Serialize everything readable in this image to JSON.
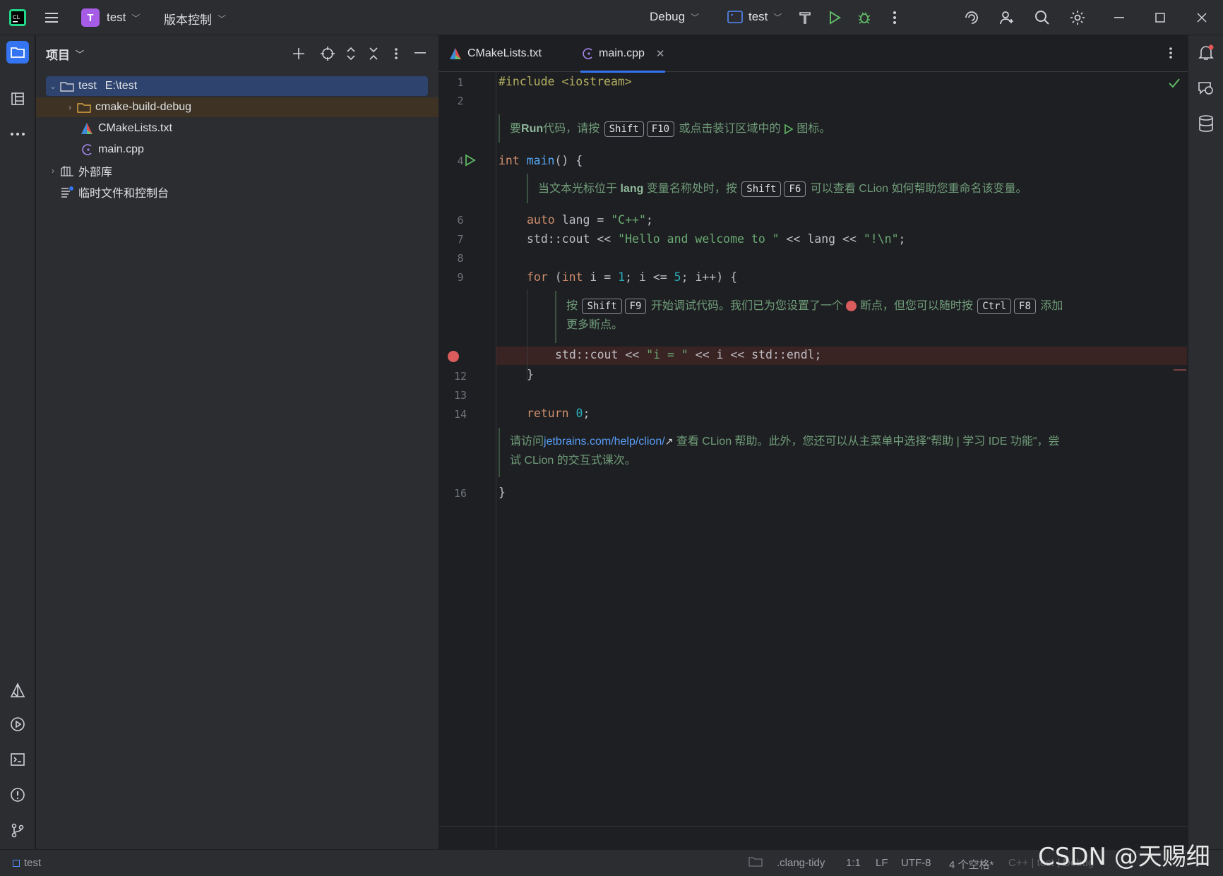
{
  "titlebar": {
    "project_initial": "T",
    "project_name": "test",
    "vcs_menu": "版本控制",
    "run_config": "Debug",
    "target": "test"
  },
  "project_panel": {
    "title": "项目",
    "tree": [
      {
        "label": "test",
        "hint": "E:\\test",
        "icon": "folder-icon"
      },
      {
        "label": "cmake-build-debug",
        "icon": "folder-icon"
      },
      {
        "label": "CMakeLists.txt",
        "icon": "cmake-icon"
      },
      {
        "label": "main.cpp",
        "icon": "cpp-file-icon"
      },
      {
        "label": "外部库",
        "icon": "library-icon"
      },
      {
        "label": "临时文件和控制台",
        "icon": "scratch-icon"
      }
    ]
  },
  "tabs": [
    {
      "label": "CMakeLists.txt"
    },
    {
      "label": "main.cpp"
    }
  ],
  "editor": {
    "line_numbers": [
      "1",
      "2",
      "4",
      "6",
      "7",
      "8",
      "9",
      "12",
      "13",
      "14",
      "16"
    ],
    "lines": {
      "l1": "#include <iostream>",
      "l4_kw": "int",
      "l4_fn": "main",
      "l4_rest": "() {",
      "l6_kw": "auto",
      "l6_mid": " lang = ",
      "l6_str": "\"C++\"",
      "l6_end": ";",
      "l7_a": "std::cout << ",
      "l7_str1": "\"Hello and welcome to \"",
      "l7_b": " << lang << ",
      "l7_str2": "\"!\\n\"",
      "l7_end": ";",
      "l9_kw1": "for",
      "l9_a": " (",
      "l9_kw2": "int",
      "l9_b": " i = ",
      "l9_n1": "1",
      "l9_c": "; i <= ",
      "l9_n2": "5",
      "l9_d": "; i++) {",
      "l11_a": "std::cout << ",
      "l11_str": "\"i = \"",
      "l11_b": " << i << std::endl;",
      "l12": "}",
      "l14_kw": "return",
      "l14_sp": " ",
      "l14_n": "0",
      "l14_end": ";",
      "l16": "}"
    },
    "hints": {
      "h1_a": "要",
      "h1_b": "Run",
      "h1_c": "代码，请按",
      "h1_k1": "Shift",
      "h1_k2": "F10",
      "h1_d": "或点击装订区域中的",
      "h1_e": "图标。",
      "h2_a": "当文本光标位于",
      "h2_b": "lang",
      "h2_c": "变量名称处时，按",
      "h2_k1": "Shift",
      "h2_k2": "F6",
      "h2_d": "可以查看 CLion 如何帮助您重命名该变量。",
      "h3_a": "按",
      "h3_k1": "Shift",
      "h3_k2": "F9",
      "h3_b": "开始调试代码。我们已为您设置了一个",
      "h3_c": "断点，但您可以随时按",
      "h3_k3": "Ctrl",
      "h3_k4": "F8",
      "h3_d": "添加",
      "h3_e": "更多断点。",
      "h4_a": "请访问",
      "h4_link": "jetbrains.com/help/clion/",
      "h4_b": "查看 CLion 帮助。此外，您还可以从主菜单中选择\"帮助 | 学习 IDE 功能\"，尝",
      "h4_c": "试 CLion 的交互式课次。"
    }
  },
  "statusbar": {
    "project": "test",
    "linter": ".clang-tidy",
    "position": "1:1",
    "line_sep": "LF",
    "encoding": "UTF-8",
    "indent": "4 个空格*",
    "context": "C++ | test | Debug"
  },
  "watermark": "CSDN @天赐细莲",
  "colors": {
    "accent": "#3574f0",
    "breakpoint": "#db5c5c",
    "run_green": "#5fb865"
  }
}
